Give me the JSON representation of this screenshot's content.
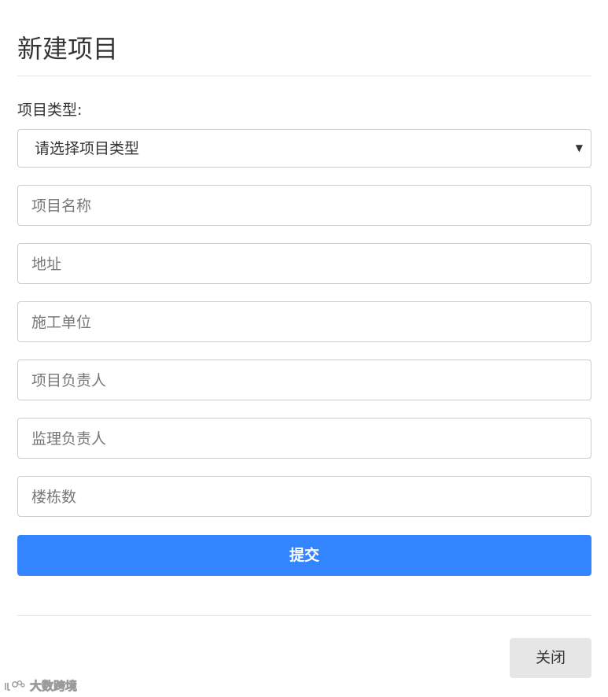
{
  "modal": {
    "title": "新建项目",
    "type_label": "项目类型:",
    "type_select": {
      "selected": "请选择项目类型"
    },
    "fields": [
      {
        "placeholder": "项目名称"
      },
      {
        "placeholder": "地址"
      },
      {
        "placeholder": "施工单位"
      },
      {
        "placeholder": "项目负责人"
      },
      {
        "placeholder": "监理负责人"
      },
      {
        "placeholder": "楼栋数"
      }
    ],
    "submit_label": "提交",
    "close_label": "关闭"
  },
  "watermark": {
    "text": "大数跨境"
  },
  "colors": {
    "primary": "#3385ff",
    "close_bg": "#e6e6e6",
    "border": "#cccccc"
  }
}
